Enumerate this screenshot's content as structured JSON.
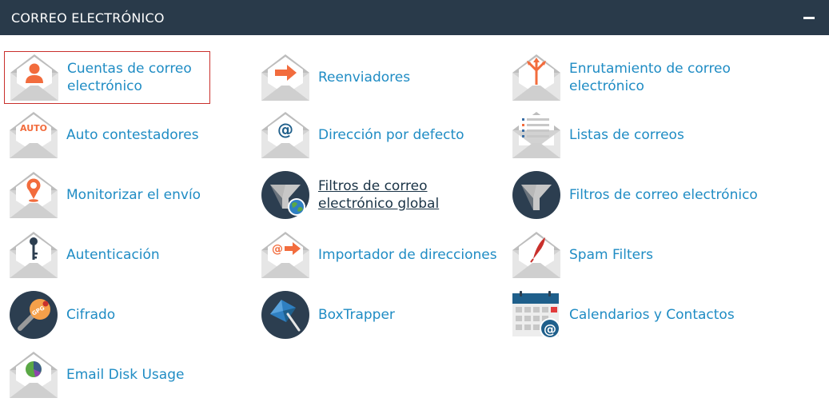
{
  "header": {
    "title": "CORREO ELECTRÓNICO"
  },
  "items": [
    {
      "label": "Cuentas de correo electrónico",
      "icon": "email-accounts-icon"
    },
    {
      "label": "Reenviadores",
      "icon": "forwarders-icon"
    },
    {
      "label": "Enrutamiento de correo electrónico",
      "icon": "email-routing-icon"
    },
    {
      "label": "Auto contestadores",
      "icon": "autoresponders-icon",
      "icon_text": "AUTO"
    },
    {
      "label": "Dirección por defecto",
      "icon": "default-address-icon",
      "icon_text": "@"
    },
    {
      "label": "Listas de correos",
      "icon": "mailing-lists-icon"
    },
    {
      "label": "Monitorizar el envío",
      "icon": "track-delivery-icon"
    },
    {
      "label": "Filtros de correo electrónico global",
      "icon": "global-email-filters-icon"
    },
    {
      "label": "Filtros de correo electrónico",
      "icon": "email-filters-icon"
    },
    {
      "label": "Autenticación",
      "icon": "authentication-icon"
    },
    {
      "label": "Importador de direcciones",
      "icon": "address-importer-icon",
      "icon_text": "@"
    },
    {
      "label": "Spam Filters",
      "icon": "spam-filters-icon"
    },
    {
      "label": "Cifrado",
      "icon": "encryption-icon",
      "icon_text": "GPG"
    },
    {
      "label": "BoxTrapper",
      "icon": "boxtrapper-icon"
    },
    {
      "label": "Calendarios y Contactos",
      "icon": "calendars-contacts-icon",
      "icon_text": "@"
    },
    {
      "label": "Email Disk Usage",
      "icon": "email-disk-usage-icon"
    }
  ],
  "colors": {
    "header_bg": "#293a4a",
    "link": "#1f8cc4",
    "accent": "#f26c3d",
    "selected_border": "#c9302c",
    "dark_circle": "#2c3e50"
  }
}
